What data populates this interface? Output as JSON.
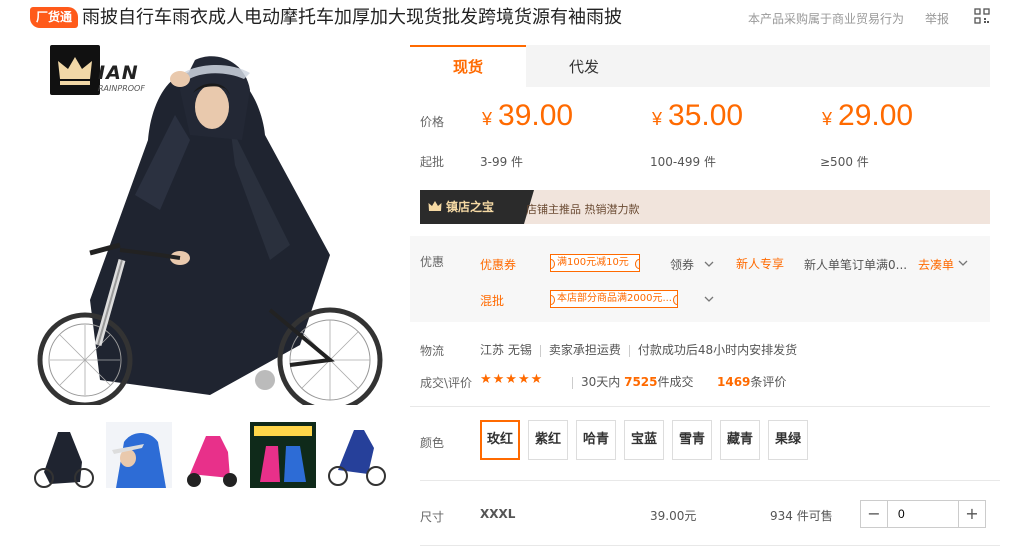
{
  "header": {
    "badge": "厂货通",
    "title": "雨披自行车雨衣成人电动摩托车加厚加大现货批发跨境货源有袖雨披",
    "trade_note": "本产品采购属于商业贸易行为",
    "report": "举报",
    "qr_icon": "qr-code-icon"
  },
  "image": {
    "brand_text": "IAN",
    "brand_sub": "RAINPROOF",
    "thumb_count": 5
  },
  "tabs": [
    {
      "label": "现货",
      "active": true
    },
    {
      "label": "代发",
      "active": false
    }
  ],
  "pricing": {
    "price_label": "价格",
    "moq_label": "起批",
    "currency": "¥",
    "tiers": [
      {
        "price": "39.00",
        "qty": "3-99 件"
      },
      {
        "price": "35.00",
        "qty": "100-499 件"
      },
      {
        "price": "29.00",
        "qty": "≥500 件"
      }
    ]
  },
  "promo": {
    "tag": "镇店之宝",
    "text": "店铺主推品  热销潜力款"
  },
  "discount": {
    "label": "优惠",
    "coupon_key": "优惠券",
    "coupon_value": "满100元减10元",
    "claim": "领券",
    "newuser_key": "新人专享",
    "newuser_text": "新人单笔订单满0...",
    "gather": "去凑单",
    "mixed_key": "混批",
    "mixed_value": "本店部分商品满2000元..."
  },
  "logistics": {
    "label": "物流",
    "origin": "江苏 无锡",
    "freight": "卖家承担运费",
    "ship": "付款成功后48小时内安排发货"
  },
  "reviews": {
    "label": "成交\\评价",
    "stars": "★★★★★",
    "rating_fraction": 1.0,
    "sold_prefix": "30天内",
    "sold_count": "7525",
    "sold_suffix": "件成交",
    "review_count": "1469",
    "review_suffix": "条评价"
  },
  "colors": {
    "label": "颜色",
    "options": [
      "玫红",
      "紫红",
      "哈青",
      "宝蓝",
      "雪青",
      "藏青",
      "果绿"
    ],
    "selected": "玫红"
  },
  "size": {
    "label": "尺寸",
    "value": "XXXL",
    "price": "39.00元",
    "stock": "934 件可售",
    "quantity": "0",
    "minus": "−",
    "plus": "+"
  },
  "colors_theme": {
    "accent": "#ff6a00",
    "badge": "#ff5a1a",
    "promo_bg": "#f1e4dc"
  }
}
